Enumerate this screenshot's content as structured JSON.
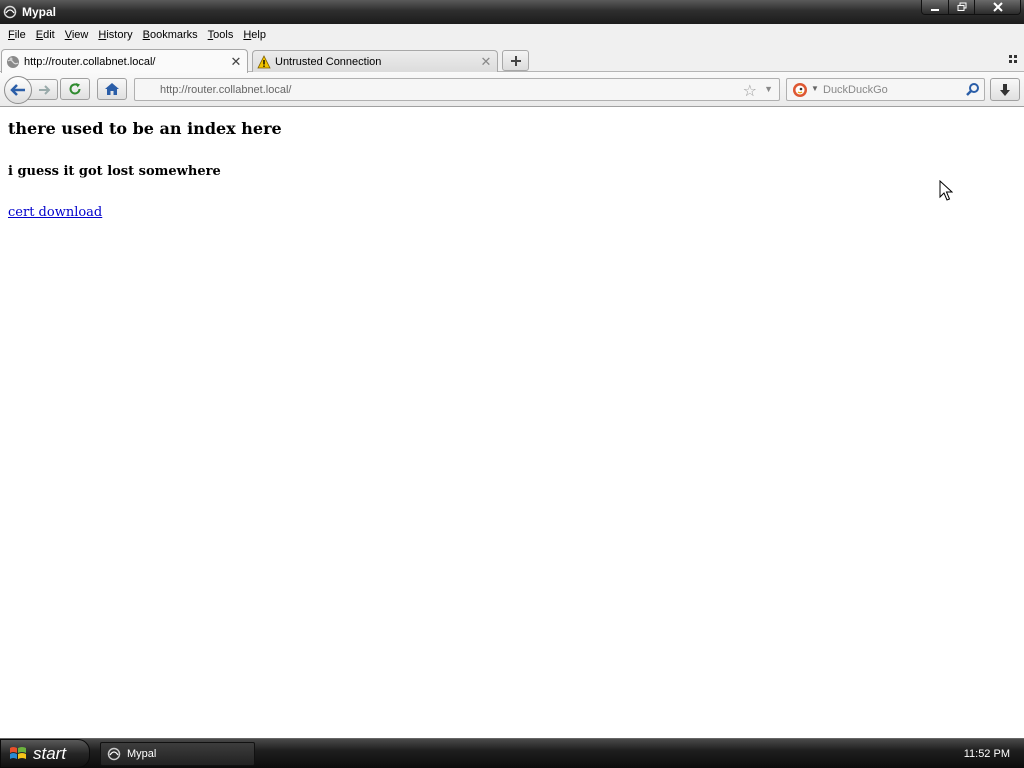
{
  "window": {
    "title": "Mypal"
  },
  "menu": [
    "File",
    "Edit",
    "View",
    "History",
    "Bookmarks",
    "Tools",
    "Help"
  ],
  "menu_mnemonics": [
    "F",
    "E",
    "V",
    "H",
    "B",
    "T",
    "H"
  ],
  "tabs": [
    {
      "label": "http://router.collabnet.local/",
      "icon": "globe-icon",
      "active": true
    },
    {
      "label": "Untrusted Connection",
      "icon": "warning-icon",
      "active": false
    }
  ],
  "urlbar": {
    "value": "http://router.collabnet.local/"
  },
  "search": {
    "placeholder": "DuckDuckGo",
    "engine_icon": "duckduckgo-icon"
  },
  "page": {
    "heading": "there used to be an index here",
    "subheading": "i guess it got lost somewhere",
    "link": "cert download"
  },
  "taskbar": {
    "start_label": "start",
    "task_label": "Mypal",
    "clock": "11:52 PM"
  },
  "colors": {
    "link": "#0000cc",
    "titlebar": "#2e2e2e",
    "taskbar": "#1e1e1e"
  }
}
